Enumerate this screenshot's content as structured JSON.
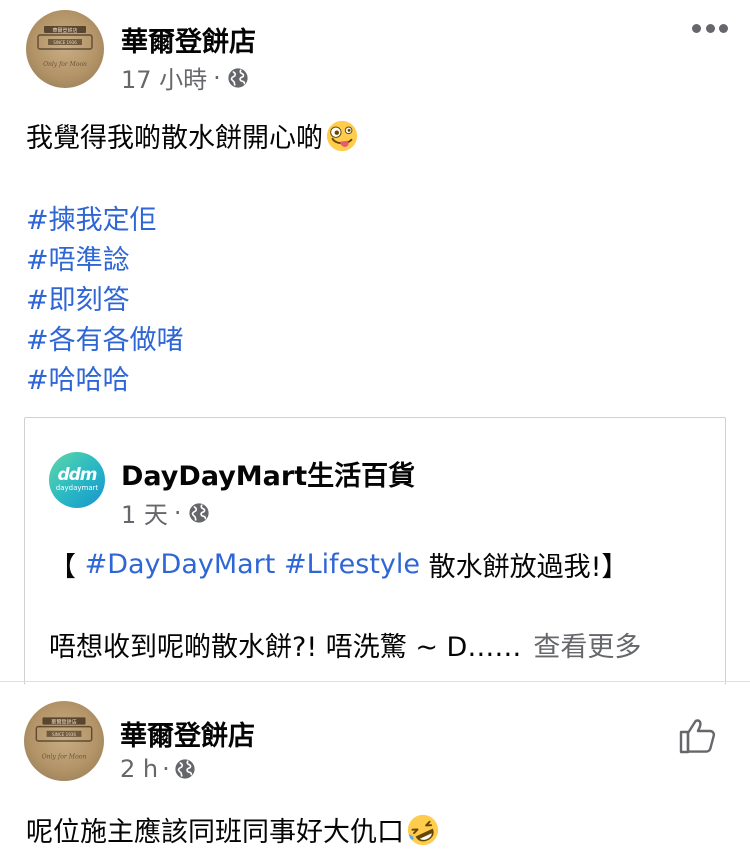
{
  "post": {
    "author": "華爾登餅店",
    "time": "17 小時",
    "separator": "·",
    "text": "我覺得我啲散水餅開心啲",
    "emoji": "zany-face",
    "hashtags": [
      "#揀我定佢",
      "#唔準諗",
      "#即刻答",
      "#各有各做啫",
      "#哈哈哈"
    ]
  },
  "avatar": {
    "sign_top": "華爾登餅店",
    "sign_year": "SINCE 1936",
    "script_text": "Only for Moon"
  },
  "shared": {
    "page_name": "DayDayMart生活百貨",
    "logo_mark": "ddm",
    "logo_sub": "daydaymart",
    "time": "1 天",
    "separator": "·",
    "bracket_open": "【 ",
    "hashtag1": "#DayDayMart",
    "hashtag2": "#Lifestyle",
    "title_rest": " 散水餅放過我!】",
    "body": "唔想收到呢啲散水餅?! 唔洗驚 ~ D……",
    "see_more": "查看更多"
  },
  "comment": {
    "author": "華爾登餅店",
    "time": "2 h",
    "separator": "·",
    "text": "呢位施主應該同班同事好大仇口",
    "emoji": "rolling-on-floor-laughing"
  },
  "colors": {
    "link": "#2f66d5",
    "secondary_text": "#65676b",
    "primary_text": "#050505",
    "border": "#ced0d4"
  }
}
